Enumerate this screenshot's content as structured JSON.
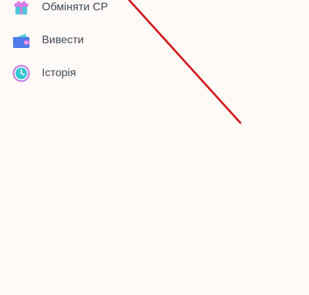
{
  "menu": {
    "items": [
      {
        "label": "Обміняти СР",
        "icon": "gift-icon"
      },
      {
        "label": "Вивести",
        "icon": "wallet-icon"
      },
      {
        "label": "Історія",
        "icon": "clock-icon"
      }
    ]
  },
  "colors": {
    "background": "#fffaf7",
    "text": "#3f4653",
    "annotation_arrow": "#d21a1a",
    "gift_box": "#4fc7d8",
    "gift_bow": "#d97be8",
    "wallet_front": "#4d7be8",
    "wallet_back": "#5ad0d6",
    "clock_ring": "#c97de3",
    "clock_face": "#36c6d4"
  }
}
